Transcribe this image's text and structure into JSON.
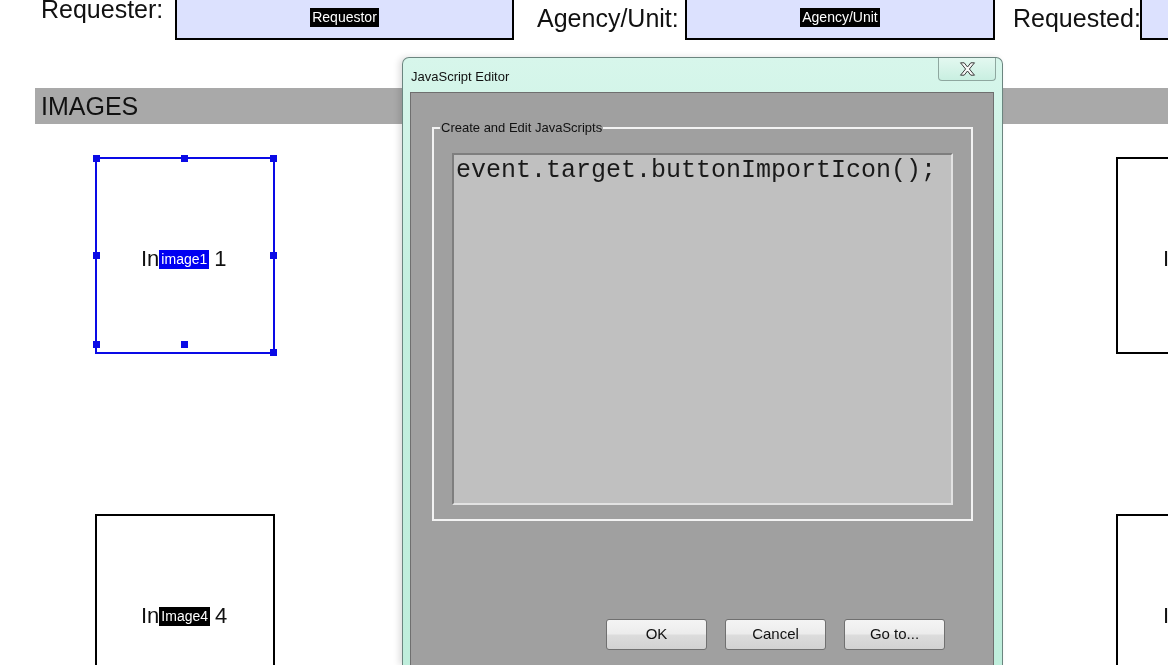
{
  "header_fields": [
    {
      "label": "Requester:",
      "field_name": "Requestor"
    },
    {
      "label": "Agency/Unit:",
      "field_name": "Agency/Unit"
    },
    {
      "label": "Requested:"
    }
  ],
  "section": {
    "title": "IMAGES"
  },
  "image_fields": [
    {
      "caption_parts": [
        "In",
        "1"
      ],
      "field_name": "image1",
      "selected": true
    },
    {
      "caption_parts": [
        "I"
      ],
      "selected": false
    },
    {
      "caption_parts": [
        "In",
        "4"
      ],
      "field_name": "Image4",
      "selected": false
    },
    {
      "caption_parts": [
        "I"
      ],
      "selected": false
    }
  ],
  "dialog": {
    "title": "JavaScript Editor",
    "group_label": "Create and Edit JavaScripts",
    "script": "event.target.buttonImportIcon();",
    "buttons": [
      "OK",
      "Cancel",
      "Go to..."
    ]
  }
}
